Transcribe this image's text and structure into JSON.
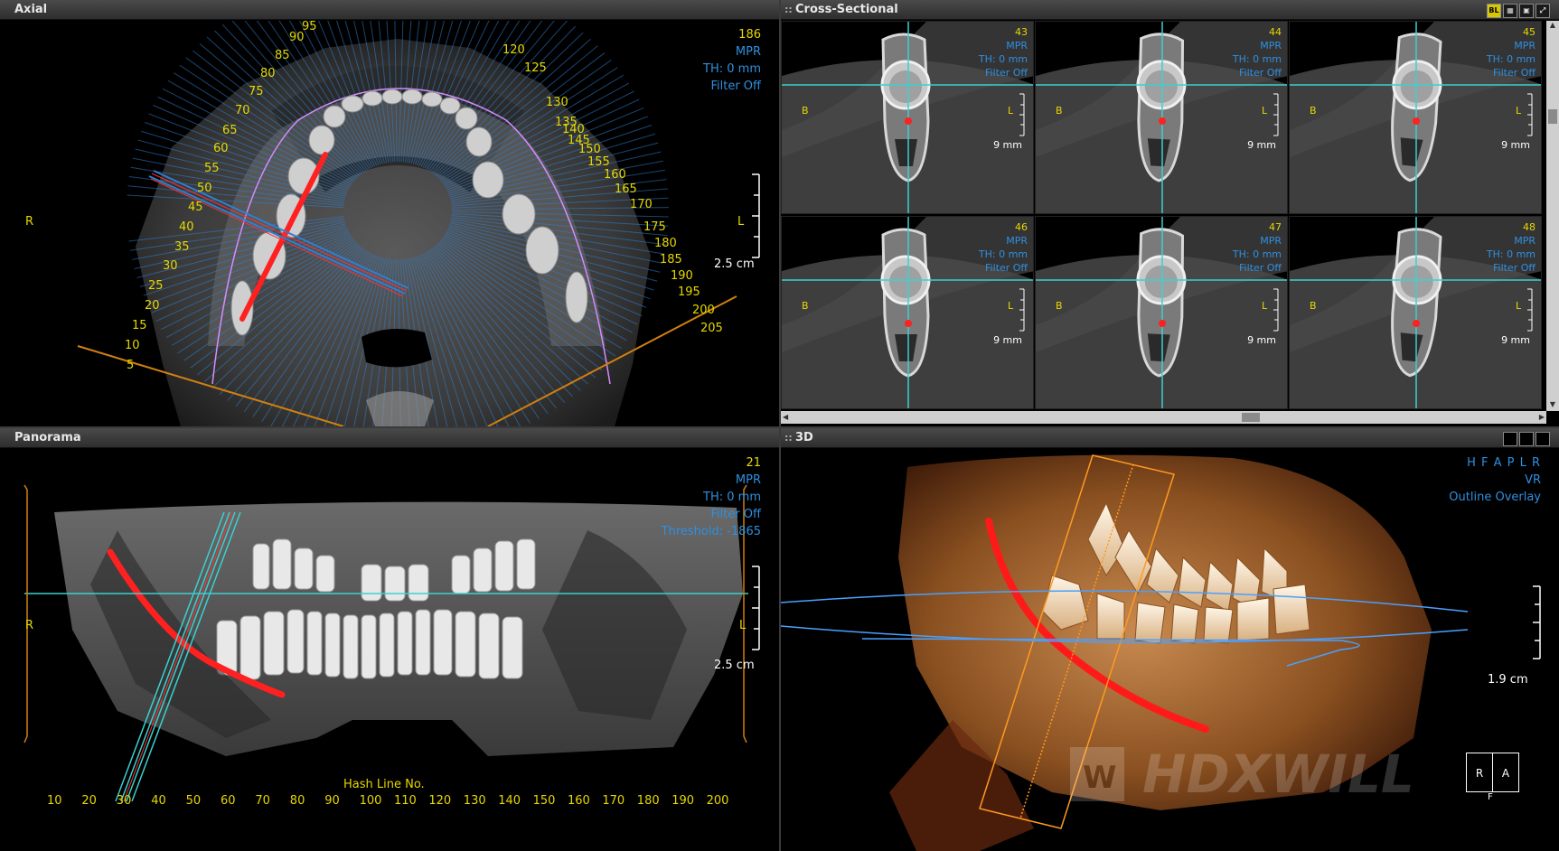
{
  "axial": {
    "title": "Axial",
    "info": {
      "slice": "186",
      "mode": "MPR",
      "thickness": "TH: 0 mm",
      "filter": "Filter Off"
    },
    "left_label": "R",
    "right_label": "L",
    "scale": "2.5 cm",
    "hash_left": [
      "5",
      "10",
      "15",
      "20",
      "25",
      "30",
      "35",
      "40",
      "45",
      "50",
      "55",
      "60",
      "65",
      "70",
      "75",
      "80",
      "85",
      "90",
      "95"
    ],
    "hash_right": [
      "120",
      "125",
      "130",
      "135",
      "140",
      "145",
      "150",
      "155",
      "160",
      "165",
      "170",
      "175",
      "180",
      "185",
      "190",
      "195",
      "200",
      "205"
    ]
  },
  "cross": {
    "title": "Cross-Sectional",
    "toolbar": [
      "BL",
      "grid-3x2",
      "grid-2x2",
      "fit"
    ],
    "cells": [
      {
        "slice": "43",
        "mode": "MPR",
        "th": "TH: 0 mm",
        "filter": "Filter Off",
        "left": "B",
        "right": "L",
        "scale": "9 mm"
      },
      {
        "slice": "44",
        "mode": "MPR",
        "th": "TH: 0 mm",
        "filter": "Filter Off",
        "left": "B",
        "right": "L",
        "scale": "9 mm"
      },
      {
        "slice": "45",
        "mode": "MPR",
        "th": "TH: 0 mm",
        "filter": "Filter Off",
        "left": "B",
        "right": "L",
        "scale": "9 mm"
      },
      {
        "slice": "46",
        "mode": "MPR",
        "th": "TH: 0 mm",
        "filter": "Filter Off",
        "left": "B",
        "right": "L",
        "scale": "9 mm"
      },
      {
        "slice": "47",
        "mode": "MPR",
        "th": "TH: 0 mm",
        "filter": "Filter Off",
        "left": "B",
        "right": "L",
        "scale": "9 mm"
      },
      {
        "slice": "48",
        "mode": "MPR",
        "th": "TH: 0 mm",
        "filter": "Filter Off",
        "left": "B",
        "right": "L",
        "scale": "9 mm"
      }
    ]
  },
  "panorama": {
    "title": "Panorama",
    "info": {
      "slice": "21",
      "mode": "MPR",
      "thickness": "TH: 0 mm",
      "filter": "Filter Off",
      "threshold": "Threshold: -1865"
    },
    "left_label": "R",
    "right_label": "L",
    "scale": "2.5 cm",
    "axis_title": "Hash Line No.",
    "axis_ticks": [
      "10",
      "20",
      "30",
      "40",
      "50",
      "60",
      "70",
      "80",
      "90",
      "100",
      "110",
      "120",
      "130",
      "140",
      "150",
      "160",
      "170",
      "180",
      "190",
      "200"
    ]
  },
  "view3d": {
    "title": "3D",
    "info": {
      "orient": "H F A P L R",
      "mode": "VR",
      "overlay": "Outline Overlay"
    },
    "scale": "1.9 cm",
    "cube": {
      "left": "R",
      "right": "A",
      "bottom": "F"
    },
    "watermark": "HDXWILL",
    "watermark_badge": "W"
  }
}
